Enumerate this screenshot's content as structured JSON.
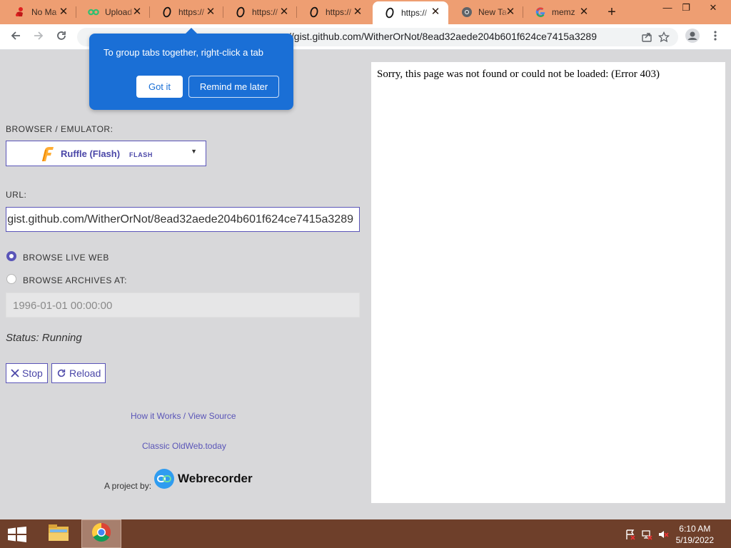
{
  "browser": {
    "tabs": [
      {
        "title": "No Ma",
        "icon": "red-figure-icon",
        "active": false
      },
      {
        "title": "Upload",
        "icon": "green-glasses-icon",
        "active": false
      },
      {
        "title": "https://",
        "icon": "oldweb-o-icon",
        "active": false
      },
      {
        "title": "https://",
        "icon": "oldweb-o-icon",
        "active": false
      },
      {
        "title": "https://",
        "icon": "oldweb-o-icon",
        "active": false
      },
      {
        "title": "https://",
        "icon": "oldweb-o-icon",
        "active": true
      },
      {
        "title": "New Ta",
        "icon": "chrome-icon",
        "active": false
      },
      {
        "title": "memz",
        "icon": "google-g-icon",
        "active": false
      }
    ],
    "tab_close_glyph": "✕",
    "new_tab_glyph": "+",
    "window_controls": {
      "minimize": "—",
      "restore": "❐",
      "close": "✕"
    },
    "address": {
      "prefix": "",
      "url": "//gist.github.com/WitherOrNot/8ead32aede204b601f624ce7415a3289"
    }
  },
  "popup": {
    "message": "To group tabs together, right-click a tab",
    "got_it_label": "Got it",
    "remind_label": "Remind me later"
  },
  "panel": {
    "emulator_label": "BROWSER / EMULATOR:",
    "emulator_name": "Ruffle (Flash)",
    "emulator_tag": "FLASH",
    "url_label": "URL:",
    "url_value": "gist.github.com/WitherOrNot/8ead32aede204b601f624ce7415a3289",
    "live_web_label": "BROWSE LIVE WEB",
    "archives_label": "BROWSE ARCHIVES AT:",
    "archive_placeholder": "1996-01-01 00:00:00",
    "status": "Status: Running",
    "stop_label": "Stop",
    "reload_label": "Reload",
    "link_how": "How it Works / View Source",
    "link_classic": "Classic OldWeb.today",
    "project_label": "A project by:",
    "org_name": "Webrecorder"
  },
  "frame": {
    "message": "Sorry, this page was not found or could not be loaded: (Error 403)"
  },
  "taskbar": {
    "apps": [
      "file-explorer-icon",
      "chrome-icon"
    ],
    "time": "6:10 AM",
    "date": "5/19/2022"
  },
  "colors": {
    "tabstrip": "#ee9e72",
    "accent": "#5a55b8",
    "popup": "#1a6fd6",
    "taskbar": "#6e3f2a"
  }
}
